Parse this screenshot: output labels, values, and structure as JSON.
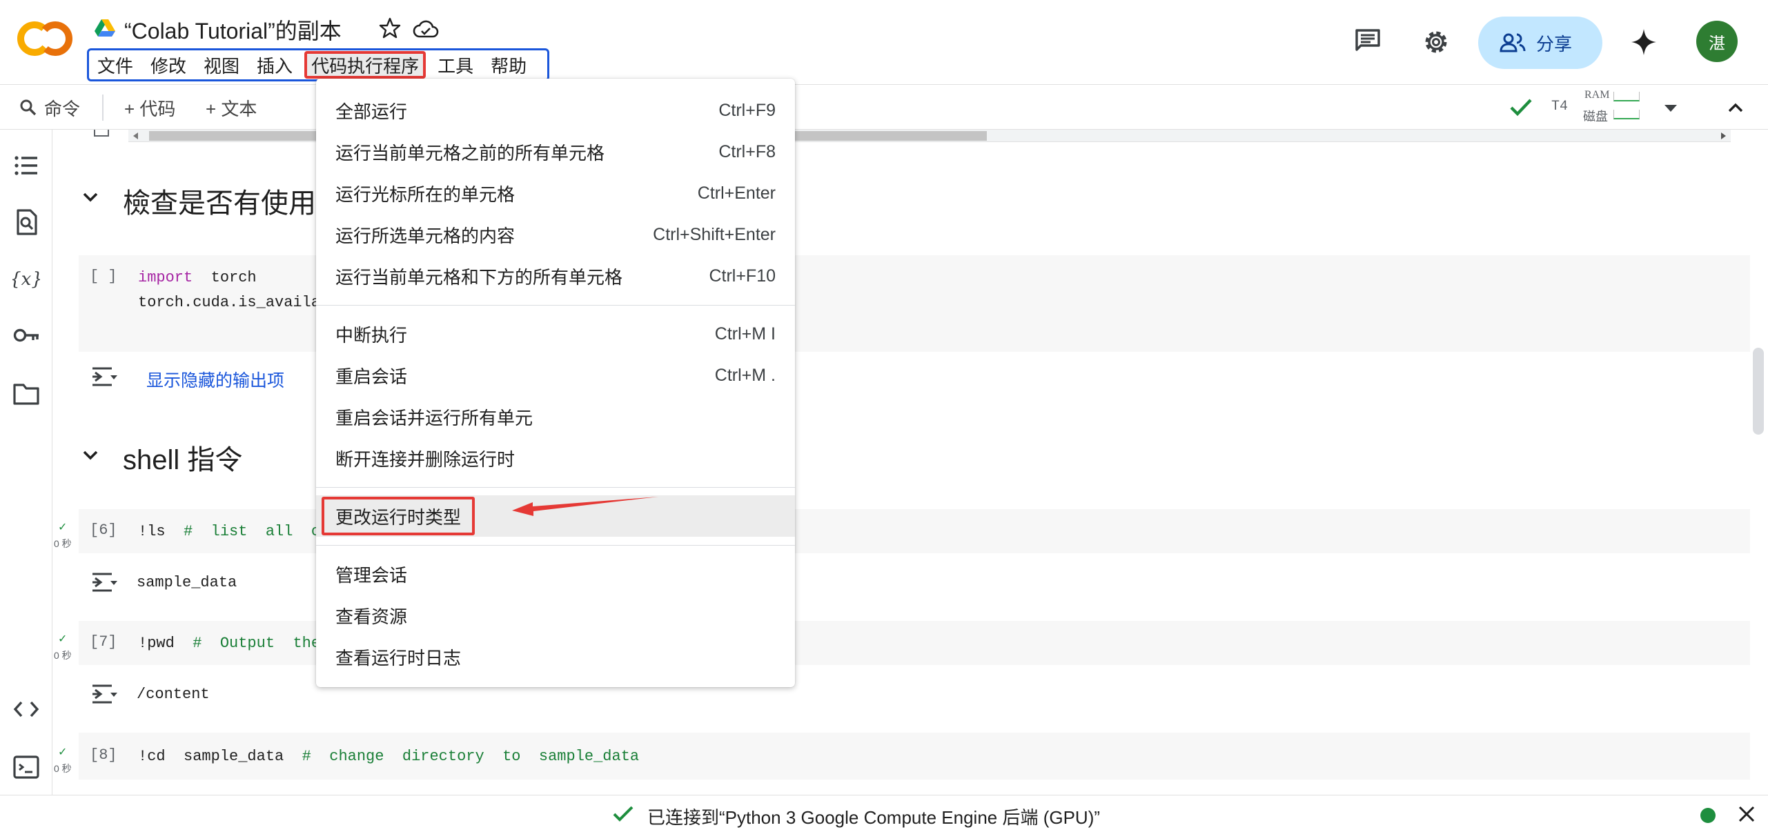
{
  "header": {
    "title": "“Colab Tutorial”的副本",
    "menu": [
      "文件",
      "修改",
      "视图",
      "插入",
      "代码执行程序",
      "工具",
      "帮助"
    ],
    "share_label": "分享",
    "avatar_letter": "湛"
  },
  "toolbar": {
    "command_label": "命令",
    "add_code_label": "+ 代码",
    "add_text_label": "+ 文本",
    "runtime_type": "T4",
    "ram_label": "RAM",
    "disk_label": "磁盘"
  },
  "sidebar": {
    "icons": [
      "table-of-contents-icon",
      "find-replace-icon",
      "variables-icon",
      "secrets-key-icon",
      "files-folder-icon",
      "code-snippets-icon",
      "terminal-icon"
    ]
  },
  "notebook": {
    "section1_title": "檢查是否有使用",
    "cell1": {
      "exec": "[ ]",
      "line1_kw": "import",
      "line1_rest": "  torch",
      "line2": "torch.cuda.is_availa",
      "show_hidden": "显示隐藏的输出项"
    },
    "section2_title": "shell 指令",
    "cell6": {
      "check": "✓",
      "time": "0 秒",
      "exec": "[6]",
      "cmd": "!ls",
      "comment": "#  list  all  c",
      "output": "sample_data"
    },
    "cell7": {
      "check": "✓",
      "time": "0 秒",
      "exec": "[7]",
      "cmd": "!pwd",
      "comment": "#  Output  the",
      "output": "/content"
    },
    "cell8": {
      "check": "✓",
      "time": "0 秒",
      "exec": "[8]",
      "cmd": "!cd  sample_data",
      "comment": "#  change  directory  to  sample_data"
    }
  },
  "dropdown": {
    "items": [
      {
        "label": "全部运行",
        "shortcut": "Ctrl+F9"
      },
      {
        "label": "运行当前单元格之前的所有单元格",
        "shortcut": "Ctrl+F8"
      },
      {
        "label": "运行光标所在的单元格",
        "shortcut": "Ctrl+Enter"
      },
      {
        "label": "运行所选单元格的内容",
        "shortcut": "Ctrl+Shift+Enter"
      },
      {
        "label": "运行当前单元格和下方的所有单元格",
        "shortcut": "Ctrl+F10"
      },
      {
        "label": "中断执行",
        "shortcut": "Ctrl+M I"
      },
      {
        "label": "重启会话",
        "shortcut": "Ctrl+M ."
      },
      {
        "label": "重启会话并运行所有单元",
        "shortcut": ""
      },
      {
        "label": "断开连接并删除运行时",
        "shortcut": ""
      },
      {
        "label": "更改运行时类型",
        "shortcut": ""
      },
      {
        "label": "管理会话",
        "shortcut": ""
      },
      {
        "label": "查看资源",
        "shortcut": ""
      },
      {
        "label": "查看运行时日志",
        "shortcut": ""
      }
    ]
  },
  "status": {
    "text": "已连接到“Python 3 Google Compute Engine 后端 (GPU)”"
  },
  "colors": {
    "accent_blue": "#1a56db",
    "highlight_red": "#e53935",
    "success_green": "#1e8e3e",
    "share_bg": "#c2e7ff"
  }
}
